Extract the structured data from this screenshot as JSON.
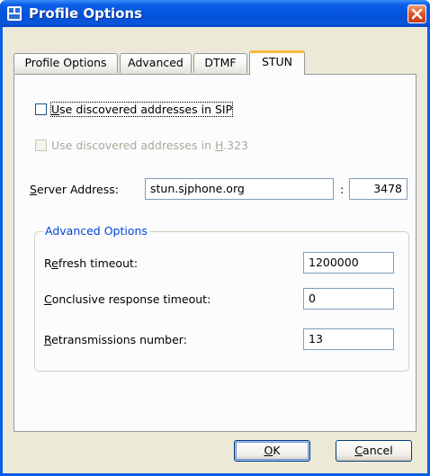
{
  "window": {
    "title": "Profile Options"
  },
  "tabs": [
    {
      "label": "Profile Options"
    },
    {
      "label": "Advanced"
    },
    {
      "label": "DTMF"
    },
    {
      "label": "STUN"
    }
  ],
  "stun": {
    "use_sip": {
      "label_pre": "",
      "mnemonic": "U",
      "label_post": "se discovered addresses in SIP",
      "checked": false
    },
    "use_h323": {
      "label_pre": "Use discovered addresses in ",
      "mnemonic": "H",
      "label_post": ".323",
      "checked": false,
      "enabled": false
    },
    "server_address": {
      "label_mnemonic": "S",
      "label_post": "erver Address:",
      "value": "stun.sjphone.org",
      "separator": ":",
      "port": "3478"
    },
    "advanced": {
      "title": "Advanced Options",
      "refresh": {
        "label_pre": "R",
        "mnemonic": "e",
        "label_post": "fresh timeout:",
        "value": "1200000"
      },
      "conclusive": {
        "label_pre": "",
        "mnemonic": "C",
        "label_post": "onclusive response timeout:",
        "value": "0"
      },
      "retrans": {
        "label_pre": "",
        "mnemonic": "R",
        "label_post": "etransmissions number:",
        "value": "13"
      }
    }
  },
  "buttons": {
    "ok": {
      "mnemonic": "O",
      "label_post": "K"
    },
    "cancel": {
      "mnemonic": "C",
      "label_post": "ancel"
    }
  }
}
